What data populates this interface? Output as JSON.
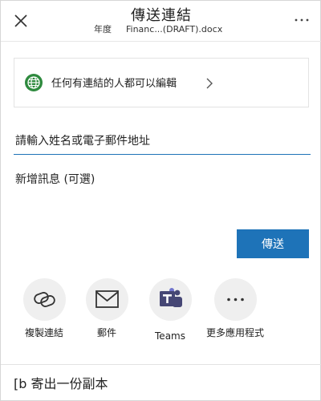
{
  "header": {
    "title": "傳送連結",
    "section_label": "年度",
    "document_name": "Financ...(DRAFT).docx"
  },
  "link_settings": {
    "label": "任何有連結的人都可以編輯"
  },
  "recipient_input": {
    "placeholder": "請輸入姓名或電子郵件地址",
    "value": ""
  },
  "message_input": {
    "placeholder": "新增訊息 (可選)",
    "value": ""
  },
  "send_button": {
    "label": "傳送"
  },
  "share_targets": [
    {
      "id": "copy-link",
      "label": "複製連結",
      "icon": "link-icon"
    },
    {
      "id": "email",
      "label": "郵件",
      "icon": "mail-icon"
    },
    {
      "id": "teams",
      "label": "Teams",
      "icon": "teams-icon"
    },
    {
      "id": "more-apps",
      "label": "更多應用程式",
      "icon": "more-icon"
    }
  ],
  "footer": {
    "copy_label": "[b 寄出一份副本"
  },
  "colors": {
    "accent": "#1e73b8",
    "globe": "#2e8a3e",
    "teams": "#464775"
  }
}
